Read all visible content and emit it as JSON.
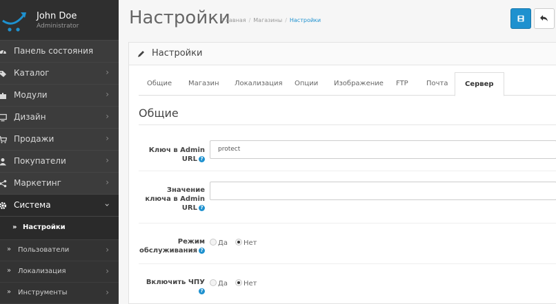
{
  "user": {
    "name": "John Doe",
    "role": "Administrator"
  },
  "nav": [
    {
      "label": "Панель состояния",
      "icon": "dashboard-icon",
      "chevron": ""
    },
    {
      "label": "Каталог",
      "icon": "tag-icon",
      "chevron": "›"
    },
    {
      "label": "Модули",
      "icon": "puzzle-icon",
      "chevron": "›"
    },
    {
      "label": "Дизайн",
      "icon": "monitor-icon",
      "chevron": "›"
    },
    {
      "label": "Продажи",
      "icon": "cart-icon",
      "chevron": "›"
    },
    {
      "label": "Покупатели",
      "icon": "user-icon",
      "chevron": "›"
    },
    {
      "label": "Маркетинг",
      "icon": "share-icon",
      "chevron": "›"
    },
    {
      "label": "Система",
      "icon": "cog-icon",
      "chevron": "›"
    }
  ],
  "subnav": [
    {
      "label": "Настройки",
      "arrow": "»",
      "chevron": ""
    },
    {
      "label": "Пользователи",
      "arrow": "»",
      "chevron": "›"
    },
    {
      "label": "Локализация",
      "arrow": "»",
      "chevron": "›"
    },
    {
      "label": "Инструменты",
      "arrow": "»",
      "chevron": "›"
    }
  ],
  "header": {
    "title": "Настройки",
    "breadcrumbs": [
      "Главная",
      "Магазины",
      "Настройки"
    ],
    "separator": "/"
  },
  "panel": {
    "title": "Настройки"
  },
  "tabs": [
    "Общие",
    "Магазин",
    "Локализация",
    "Опции",
    "Изображение",
    "FTP",
    "Почта",
    "Сервер"
  ],
  "section": {
    "legend": "Общие"
  },
  "fields": {
    "admin_key": {
      "label": "Ключ в Admin URL",
      "value": "protect"
    },
    "admin_key_value": {
      "label": "Значение ключа в Admin URL",
      "value": ""
    },
    "maintenance": {
      "label": "Режим обслуживания",
      "yes": "Да",
      "no": "Нет",
      "selected": "no"
    },
    "seo_urls": {
      "label": "Включить ЧПУ",
      "yes": "Да",
      "no": "Нет",
      "selected": "no"
    }
  },
  "help_glyph": "?",
  "colors": {
    "primary": "#1e91cf",
    "sidebar": "#3c3c3c"
  }
}
